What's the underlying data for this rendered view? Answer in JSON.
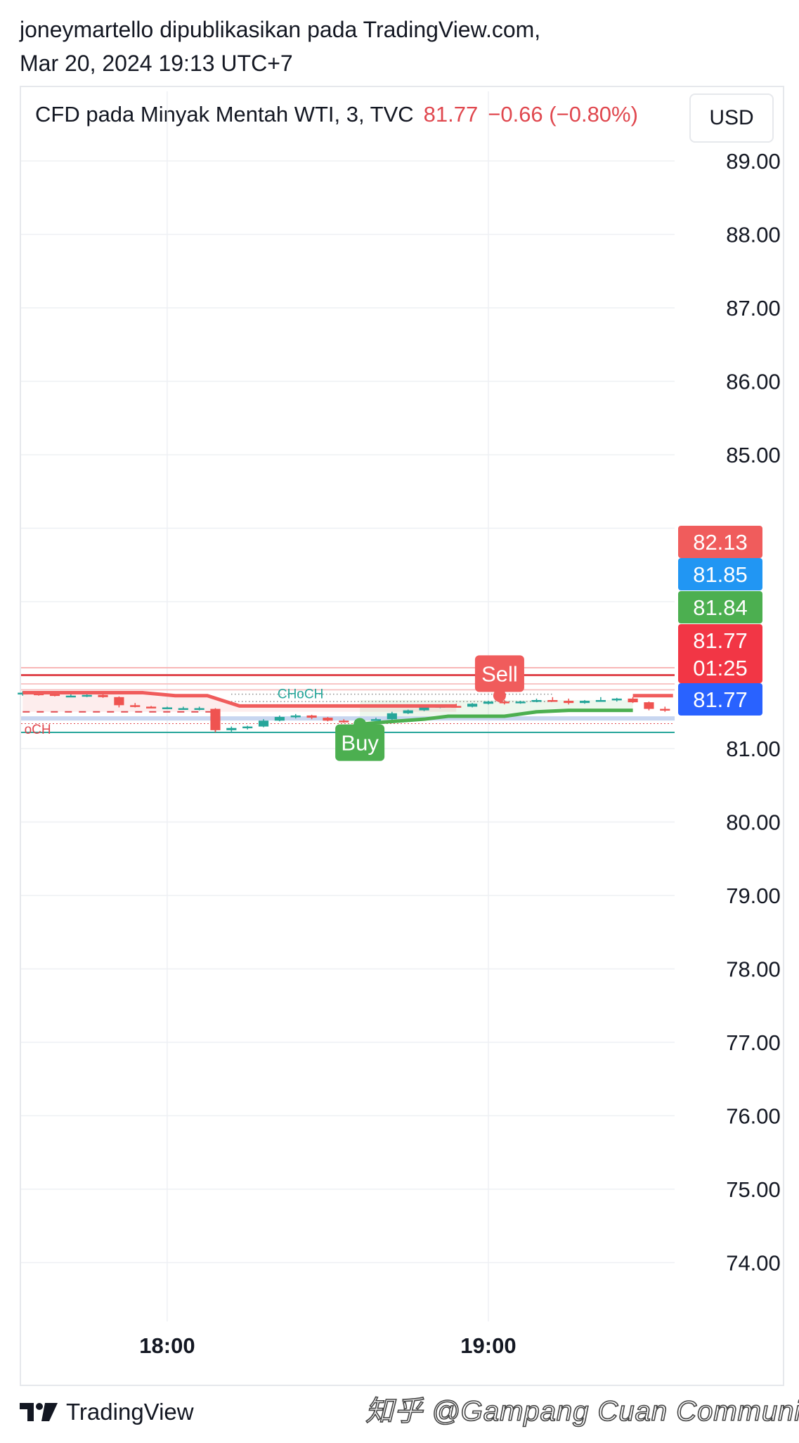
{
  "publisher": {
    "line1": "joneymartello dipublikasikan pada TradingView.com,",
    "line2": "Mar 20, 2024 19:13 UTC+7"
  },
  "header": {
    "symbol": "CFD pada Minyak Mentah WTI, 3, TVC",
    "price": "81.77",
    "change": "−0.66 (−0.80%)",
    "currency_button": "USD"
  },
  "footer": {
    "brand": "TradingView",
    "watermark": "知乎 @Gampang Cuan Community"
  },
  "colors": {
    "up": "#26a69a",
    "down": "#ef5350",
    "buy": "#4caf50",
    "sell": "#f05c5c",
    "blue": "#2196f3",
    "grid": "#f0f3fa"
  },
  "chart_data": {
    "type": "candlestick",
    "title": "CFD pada Minyak Mentah WTI, 3, TVC",
    "ylim": [
      73.2,
      89.9
    ],
    "y_ticks": [
      "89.00",
      "88.00",
      "87.00",
      "86.00",
      "85.00",
      "81.00",
      "80.00",
      "79.00",
      "78.00",
      "77.00",
      "76.00",
      "75.00",
      "74.00"
    ],
    "x_ticks": [
      {
        "label": "18:00",
        "x": 0
      },
      {
        "label": "19:00",
        "x": 20
      }
    ],
    "x_range": [
      -9.1,
      31.6
    ],
    "price_labels": [
      {
        "value": "82.13",
        "price": 82.13,
        "bg": "#f05c5c"
      },
      {
        "value": "81.85",
        "price": 81.85,
        "bg": "#2196f3"
      },
      {
        "value": "81.84",
        "price": 81.84,
        "bg": "#4caf50"
      },
      {
        "value": "81.77",
        "price": 81.77,
        "bg": "#f23645",
        "subtext": "01:25"
      },
      {
        "value": "81.77",
        "price": 81.77,
        "bg": "#2962ff"
      }
    ],
    "candles": [
      {
        "x": -9,
        "o": 81.75,
        "h": 81.78,
        "l": 81.72,
        "c": 81.76
      },
      {
        "x": -8,
        "o": 81.75,
        "h": 81.77,
        "l": 81.72,
        "c": 81.74
      },
      {
        "x": -7,
        "o": 81.74,
        "h": 81.75,
        "l": 81.71,
        "c": 81.72
      },
      {
        "x": -6,
        "o": 81.72,
        "h": 81.74,
        "l": 81.7,
        "c": 81.72
      },
      {
        "x": -5,
        "o": 81.72,
        "h": 81.75,
        "l": 81.7,
        "c": 81.73
      },
      {
        "x": -4,
        "o": 81.73,
        "h": 81.74,
        "l": 81.69,
        "c": 81.7
      },
      {
        "x": -3,
        "o": 81.7,
        "h": 81.71,
        "l": 81.56,
        "c": 81.59
      },
      {
        "x": -2,
        "o": 81.59,
        "h": 81.62,
        "l": 81.56,
        "c": 81.57
      },
      {
        "x": -1,
        "o": 81.57,
        "h": 81.58,
        "l": 81.55,
        "c": 81.56
      },
      {
        "x": 0,
        "o": 81.56,
        "h": 81.57,
        "l": 81.55,
        "c": 81.56
      },
      {
        "x": 1,
        "o": 81.55,
        "h": 81.57,
        "l": 81.54,
        "c": 81.55
      },
      {
        "x": 2,
        "o": 81.55,
        "h": 81.57,
        "l": 81.52,
        "c": 81.55
      },
      {
        "x": 3,
        "o": 81.54,
        "h": 81.55,
        "l": 81.22,
        "c": 81.25
      },
      {
        "x": 4,
        "o": 81.25,
        "h": 81.3,
        "l": 81.23,
        "c": 81.28
      },
      {
        "x": 5,
        "o": 81.28,
        "h": 81.31,
        "l": 81.26,
        "c": 81.3
      },
      {
        "x": 6,
        "o": 81.3,
        "h": 81.4,
        "l": 81.29,
        "c": 81.38
      },
      {
        "x": 7,
        "o": 81.38,
        "h": 81.45,
        "l": 81.37,
        "c": 81.43
      },
      {
        "x": 8,
        "o": 81.43,
        "h": 81.47,
        "l": 81.41,
        "c": 81.45
      },
      {
        "x": 9,
        "o": 81.45,
        "h": 81.46,
        "l": 81.4,
        "c": 81.42
      },
      {
        "x": 10,
        "o": 81.42,
        "h": 81.43,
        "l": 81.37,
        "c": 81.38
      },
      {
        "x": 11,
        "o": 81.38,
        "h": 81.4,
        "l": 81.35,
        "c": 81.37
      },
      {
        "x": 12,
        "o": 81.37,
        "h": 81.4,
        "l": 81.36,
        "c": 81.39
      },
      {
        "x": 13,
        "o": 81.39,
        "h": 81.42,
        "l": 81.38,
        "c": 81.4
      },
      {
        "x": 14,
        "o": 81.4,
        "h": 81.5,
        "l": 81.39,
        "c": 81.48
      },
      {
        "x": 15,
        "o": 81.48,
        "h": 81.53,
        "l": 81.47,
        "c": 81.52
      },
      {
        "x": 16,
        "o": 81.52,
        "h": 81.57,
        "l": 81.51,
        "c": 81.56
      },
      {
        "x": 17,
        "o": 81.56,
        "h": 81.6,
        "l": 81.55,
        "c": 81.58
      },
      {
        "x": 18,
        "o": 81.58,
        "h": 81.61,
        "l": 81.56,
        "c": 81.57
      },
      {
        "x": 19,
        "o": 81.57,
        "h": 81.62,
        "l": 81.56,
        "c": 81.61
      },
      {
        "x": 20,
        "o": 81.61,
        "h": 81.65,
        "l": 81.6,
        "c": 81.64
      },
      {
        "x": 21,
        "o": 81.64,
        "h": 81.66,
        "l": 81.6,
        "c": 81.62
      },
      {
        "x": 22,
        "o": 81.62,
        "h": 81.65,
        "l": 81.61,
        "c": 81.64
      },
      {
        "x": 23,
        "o": 81.64,
        "h": 81.68,
        "l": 81.63,
        "c": 81.66
      },
      {
        "x": 24,
        "o": 81.66,
        "h": 81.7,
        "l": 81.64,
        "c": 81.65
      },
      {
        "x": 25,
        "o": 81.65,
        "h": 81.68,
        "l": 81.6,
        "c": 81.62
      },
      {
        "x": 26,
        "o": 81.62,
        "h": 81.66,
        "l": 81.61,
        "c": 81.65
      },
      {
        "x": 27,
        "o": 81.65,
        "h": 81.7,
        "l": 81.64,
        "c": 81.66
      },
      {
        "x": 28,
        "o": 81.66,
        "h": 81.69,
        "l": 81.64,
        "c": 81.68
      },
      {
        "x": 29,
        "o": 81.68,
        "h": 81.7,
        "l": 81.62,
        "c": 81.63
      },
      {
        "x": 30,
        "o": 81.63,
        "h": 81.64,
        "l": 81.52,
        "c": 81.54
      },
      {
        "x": 31,
        "o": 81.54,
        "h": 81.57,
        "l": 81.5,
        "c": 81.52
      }
    ],
    "sell_line": [
      [
        -9,
        81.76
      ],
      [
        -1.5,
        81.76
      ],
      [
        0.5,
        81.72
      ],
      [
        2.5,
        81.72
      ],
      [
        4.5,
        81.58
      ],
      [
        10,
        81.58
      ],
      [
        18,
        81.58
      ]
    ],
    "buy_line": [
      [
        12,
        81.33
      ],
      [
        13.5,
        81.36
      ],
      [
        16,
        81.4
      ],
      [
        17.5,
        81.44
      ],
      [
        21,
        81.44
      ],
      [
        23,
        81.5
      ],
      [
        25,
        81.52
      ],
      [
        29,
        81.52
      ]
    ],
    "sell_stub": [
      [
        29,
        81.72
      ],
      [
        31.5,
        81.72
      ]
    ],
    "horizontal_lines": [
      {
        "price": 82.1,
        "color": "#f8b6b6",
        "width": 2
      },
      {
        "price": 82.0,
        "color": "#e0484f",
        "width": 3
      },
      {
        "price": 81.88,
        "color": "#f8c6c6",
        "width": 2
      },
      {
        "price": 81.8,
        "color": "#f8c6c6",
        "width": 2
      },
      {
        "price": 81.41,
        "color": "#c8d6f0",
        "width": 6
      },
      {
        "price": 81.34,
        "color": "#e0484f",
        "width": 1,
        "dash": "2,3"
      },
      {
        "price": 81.22,
        "color": "#26a69a",
        "width": 2
      }
    ],
    "dashed_segments": [
      {
        "price": 81.5,
        "from": -9,
        "to": 3,
        "color": "#e0484f",
        "dash": "10,10",
        "width": 2
      },
      {
        "price": 81.74,
        "from": 4,
        "to": 24,
        "color": "#555555",
        "dash": "1,4",
        "width": 1.5
      },
      {
        "price": 81.64,
        "from": 4,
        "to": 24,
        "color": "#555555",
        "dash": "1,4",
        "width": 1.5
      }
    ],
    "annotations": [
      {
        "text": "CHoCH",
        "x": 8.3,
        "price": 81.75,
        "color": "#26a69a"
      },
      {
        "text": "oCH",
        "x": -8.9,
        "price": 81.27,
        "color": "#e0484f"
      }
    ],
    "signals": [
      {
        "label": "Sell",
        "x": 20.7,
        "price": 82.02,
        "color": "#f05c5c"
      },
      {
        "label": "Buy",
        "x": 12,
        "price": 81.08,
        "color": "#4caf50"
      }
    ]
  }
}
